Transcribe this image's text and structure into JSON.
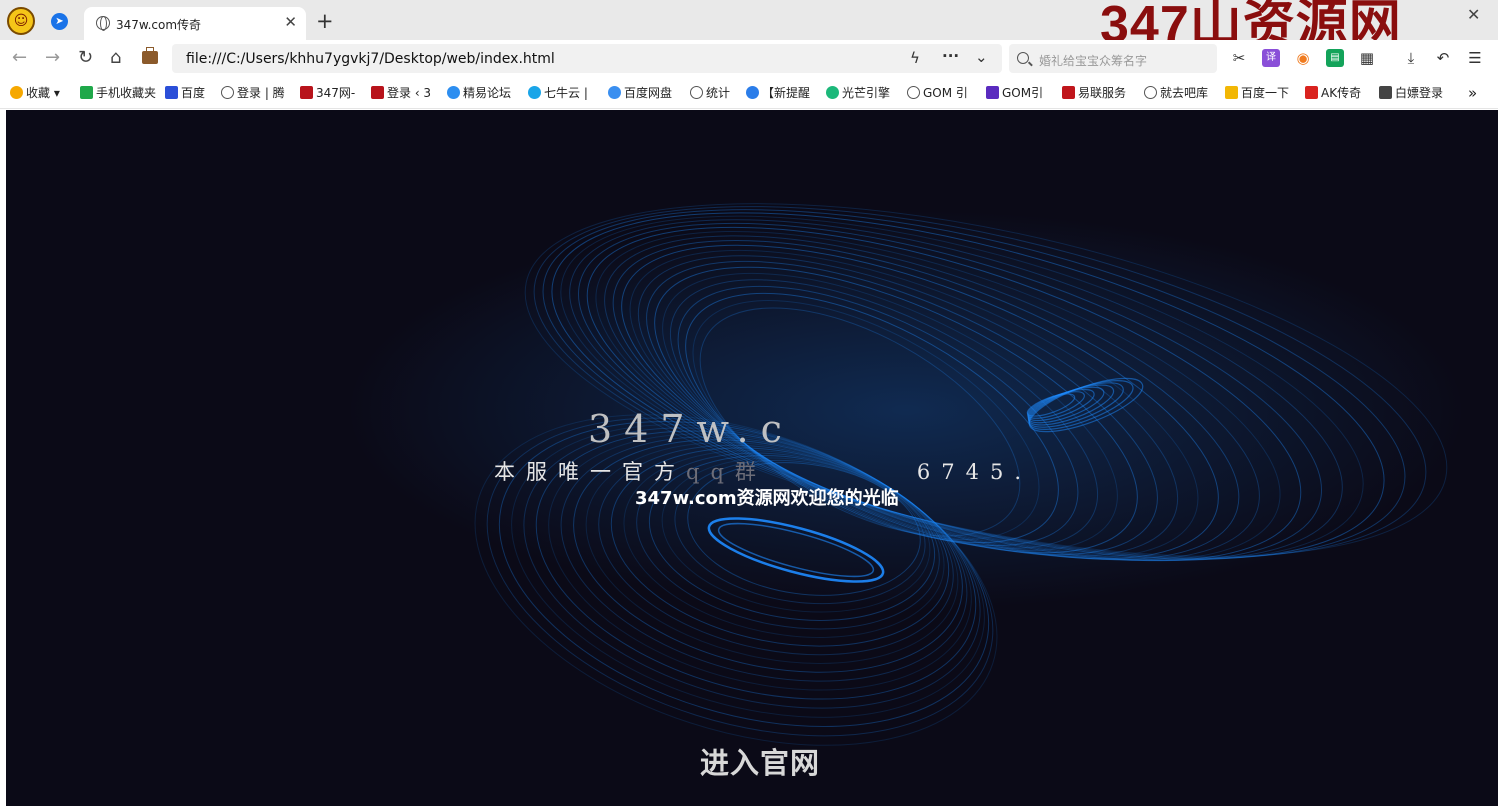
{
  "browser": {
    "tab_title": "347w.com传奇",
    "new_tab_label": "+",
    "close_tab_label": "✕",
    "window_close_label": "✕",
    "watermark": "347山资源网",
    "url": "file:///C:/Users/khhu7ygvkj7/Desktop/web/index.html",
    "search_placeholder": "婚礼给宝宝众筹名字",
    "nav_icons": [
      "back-icon",
      "forward-icon",
      "reload-icon",
      "home-icon",
      "briefcase-icon"
    ],
    "tool_icons": [
      "scissors-icon",
      "translate-icon",
      "game-icon",
      "reader-icon",
      "apps-icon",
      "download-icon",
      "undo-icon",
      "menu-icon"
    ],
    "translate_label": "译"
  },
  "bookmarks": {
    "items": [
      "收藏",
      "手机收藏夹",
      "百度",
      "登录 | 腾",
      "347网-",
      "登录 ‹ 3",
      "精易论坛",
      "七牛云 |",
      "百度网盘",
      "统计",
      "【新提醒",
      "光芒引擎",
      "GOM 引",
      "GOM引",
      "易联服务",
      "就去吧库",
      "百度一下",
      "AK传奇",
      "白嫖登录"
    ],
    "more_label": "»"
  },
  "page": {
    "site_title": "347w.c",
    "official_prefix": "本服唯一官方",
    "official_qq_mid": "qq群",
    "official_qq_num": "6745.",
    "welcome": "347w.com资源网欢迎您的光临",
    "enter_button": "进入官网",
    "background_color": "#0b0a17",
    "swirl_color": "#1e8bff"
  }
}
